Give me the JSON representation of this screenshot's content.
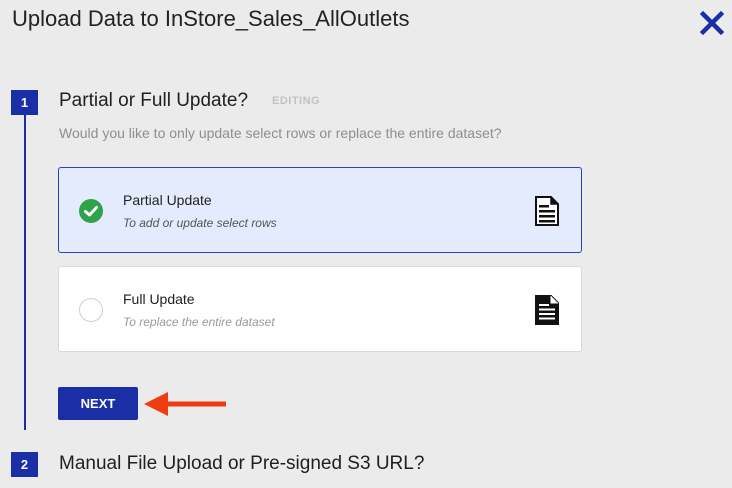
{
  "dialog": {
    "title": "Upload Data to InStore_Sales_AllOutlets",
    "close_icon": "close-icon"
  },
  "steps": [
    {
      "number": "1",
      "title": "Partial or Full Update?",
      "status": "EDITING",
      "subtitle": "Would you like to only update select rows or replace the entire dataset?",
      "options": [
        {
          "label": "Partial Update",
          "description": "To add or update select rows",
          "selected": true,
          "icon": "document-icon"
        },
        {
          "label": "Full Update",
          "description": "To replace the entire dataset",
          "selected": false,
          "icon": "document-icon"
        }
      ],
      "next_label": "NEXT"
    },
    {
      "number": "2",
      "title": "Manual File Upload or Pre-signed S3 URL?"
    }
  ],
  "colors": {
    "accent": "#1a2ea6",
    "check": "#2fa24c",
    "arrow": "#f03a12",
    "selected_bg": "#e4ebfd"
  }
}
